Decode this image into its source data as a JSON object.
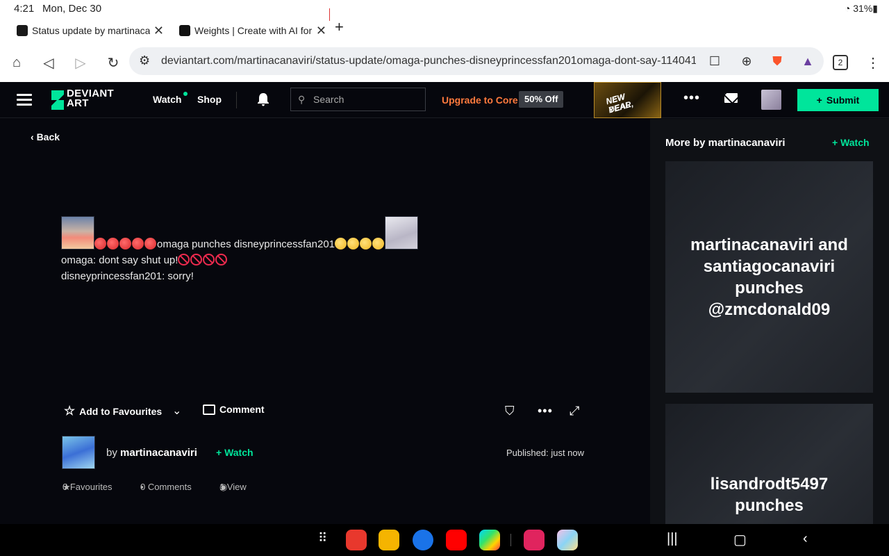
{
  "status_bar": {
    "time": "4:21",
    "date": "Mon, Dec 30",
    "battery": "31%"
  },
  "browser": {
    "tabs": [
      {
        "title": "Status update by martinacanaviri"
      },
      {
        "title": "Weights | Create with AI for Free"
      }
    ],
    "url": "deviantart.com/martinacanaviri/status-update/omaga-punches-disneyprincessfan201omaga-dont-say-114041",
    "tab_count": "2"
  },
  "header": {
    "logo_line1": "DEVIANT",
    "logo_line2": "ART",
    "nav_watch": "Watch",
    "nav_shop": "Shop",
    "search_placeholder": "Search",
    "upgrade": "Upgrade to Core",
    "discount": "50% Off",
    "promo_line1": "NEW YEAR,",
    "promo_line2": "NEW DEAL",
    "submit": "Submit",
    "more": "•••"
  },
  "post": {
    "back": "Back",
    "line1_text": "omaga punches disneyprincessfan201",
    "line2": "omaga: dont say shut up!",
    "line3": "disneyprincessfan201: sorry!",
    "add_fav": "Add to Favourites",
    "comment": "Comment",
    "by": "by",
    "author": "martinacanaviri",
    "watch": "Watch",
    "published": "Published: just now",
    "stats": {
      "favourites": "0 Favourites",
      "comments": "0 Comments",
      "views": "1 View"
    }
  },
  "sidebar": {
    "title": "More by martinacanaviri",
    "watch": "Watch",
    "cards": [
      {
        "text": "martinacanaviri and santiagocanaviri punches @zmcdonald09"
      },
      {
        "text": "lisandrodt5497 punches"
      }
    ]
  },
  "colors": {
    "accent": "#00e59b",
    "upgrade": "#ff7a3d",
    "background": "#06070d"
  }
}
